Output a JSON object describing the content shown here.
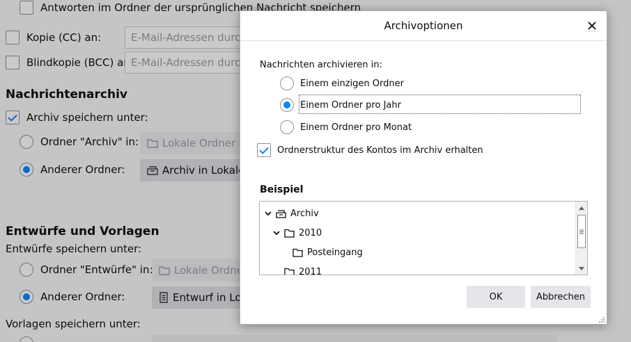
{
  "background": {
    "reply_in_folder_label": "Antworten im Ordner der ursprünglichen Nachricht speichern",
    "cc_label": "Kopie (CC) an:",
    "cc_placeholder": "E-Mail-Adressen durch",
    "bcc_label": "Blindkopie (BCC) an:",
    "bcc_placeholder": "E-Mail-Adressen durch",
    "archive_heading": "Nachrichtenarchiv",
    "archive_save_label": "Archiv speichern unter:",
    "archive_folder_radio": "Ordner \"Archiv\" in:",
    "archive_folder_value": "Lokale Ordner",
    "archive_other_radio": "Anderer Ordner:",
    "archive_other_value": "Archiv in Lokale O",
    "drafts_heading": "Entwürfe und Vorlagen",
    "drafts_save_label": "Entwürfe speichern unter:",
    "drafts_folder_radio": "Ordner \"Entwürfe\" in:",
    "drafts_folder_value": "Lokale Ordner",
    "drafts_other_radio": "Anderer Ordner:",
    "drafts_other_value": "Entwurf in Loka",
    "templates_save_label": "Vorlagen speichern unter:"
  },
  "dialog": {
    "title": "Archivoptionen",
    "archive_in_label": "Nachrichten archivieren in:",
    "options": [
      {
        "label": "Einem einzigen Ordner",
        "selected": false
      },
      {
        "label": "Einem Ordner pro Jahr",
        "selected": true
      },
      {
        "label": "Einem Ordner pro Monat",
        "selected": false
      }
    ],
    "keep_structure_label": "Ordnerstruktur des Kontos im Archiv erhalten",
    "keep_structure_checked": true,
    "example_heading": "Beispiel",
    "tree": {
      "root": "Archiv",
      "year1": "2010",
      "inbox": "Posteingang",
      "year2": "2011"
    },
    "ok_label": "OK",
    "cancel_label": "Abbrechen"
  },
  "colors": {
    "accent": "#0a84ff",
    "overlay": "rgba(12,12,13,0.22)"
  }
}
